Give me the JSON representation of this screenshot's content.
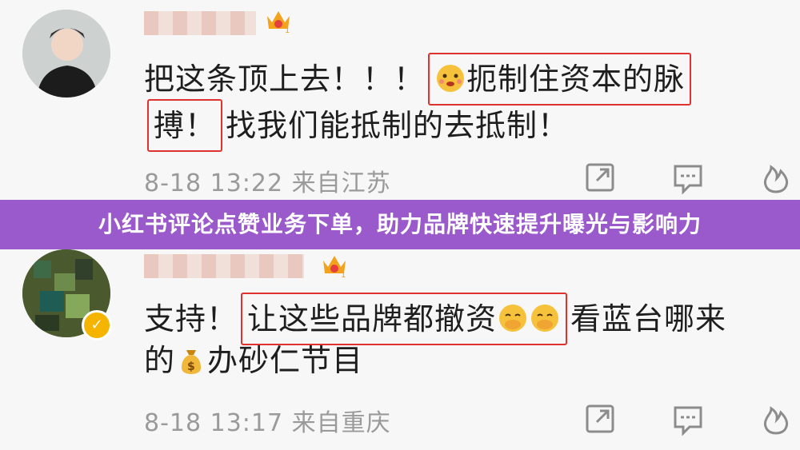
{
  "banner": {
    "text": "小红书评论点赞业务下单，助力品牌快速提升曝光与影响力"
  },
  "comments": [
    {
      "username": "",
      "text_before_highlight": "把这条顶上去！！！",
      "highlight_line1": "扼制住资本的脉",
      "highlight_line2": "搏！",
      "text_after_highlight": "找我们能抵制的去抵制！",
      "timestamp": "8-18 13:22",
      "location": "来自江苏",
      "verified": false
    },
    {
      "username": "",
      "text_before_highlight": "支持！",
      "highlight": "让这些品牌都撤资",
      "text_after_highlight_line1": "看蓝台哪来",
      "text_line2_prefix": "的",
      "text_line2_suffix": "办砂仁节目",
      "timestamp": "8-18 13:17",
      "location": "来自重庆",
      "verified": true
    }
  ],
  "icons": {
    "share": "share-icon",
    "comment": "comment-icon",
    "like": "flame-like-icon",
    "crown": "crown-badge-icon",
    "money": "money-bag-icon"
  },
  "colors": {
    "banner_bg": "#9b5acb",
    "highlight_border": "#e0322f",
    "meta_text": "#9a9a9a"
  }
}
